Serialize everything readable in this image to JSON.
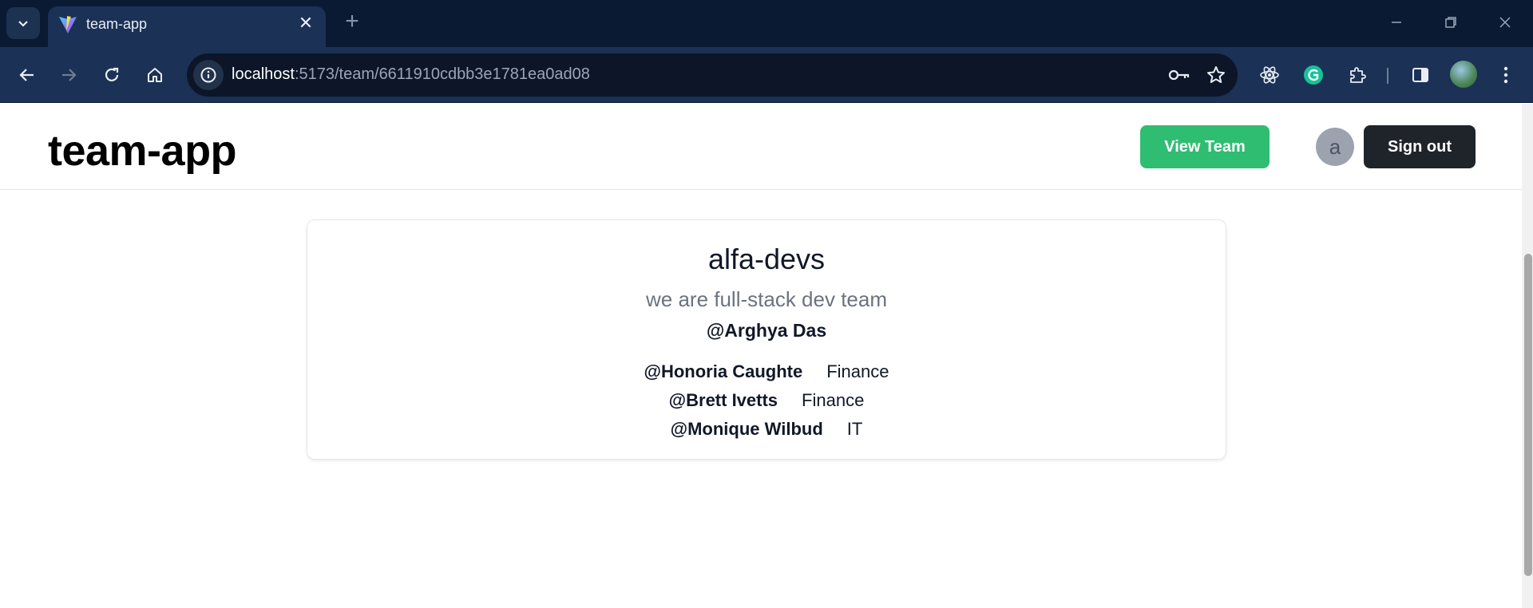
{
  "browser": {
    "tab": {
      "title": "team-app",
      "favicon": "vite-icon"
    },
    "url": {
      "host": "localhost",
      "path": ":5173/team/6611910cdbb3e1781ea0ad08"
    }
  },
  "header": {
    "logo": "team-app",
    "view_team_label": "View Team",
    "avatar_letter": "a",
    "sign_out_label": "Sign out"
  },
  "team": {
    "name": "alfa-devs",
    "description": "we are full-stack dev team",
    "owner": "@Arghya Das",
    "members": [
      {
        "name": "@Honoria Caughte",
        "department": "Finance"
      },
      {
        "name": "@Brett Ivetts",
        "department": "Finance"
      },
      {
        "name": "@Monique Wilbud",
        "department": "IT"
      }
    ]
  },
  "colors": {
    "accent_green": "#2fbd72",
    "dark_button": "#1f232a",
    "chrome_dark": "#0b1a33",
    "chrome_tab": "#1b3155"
  }
}
